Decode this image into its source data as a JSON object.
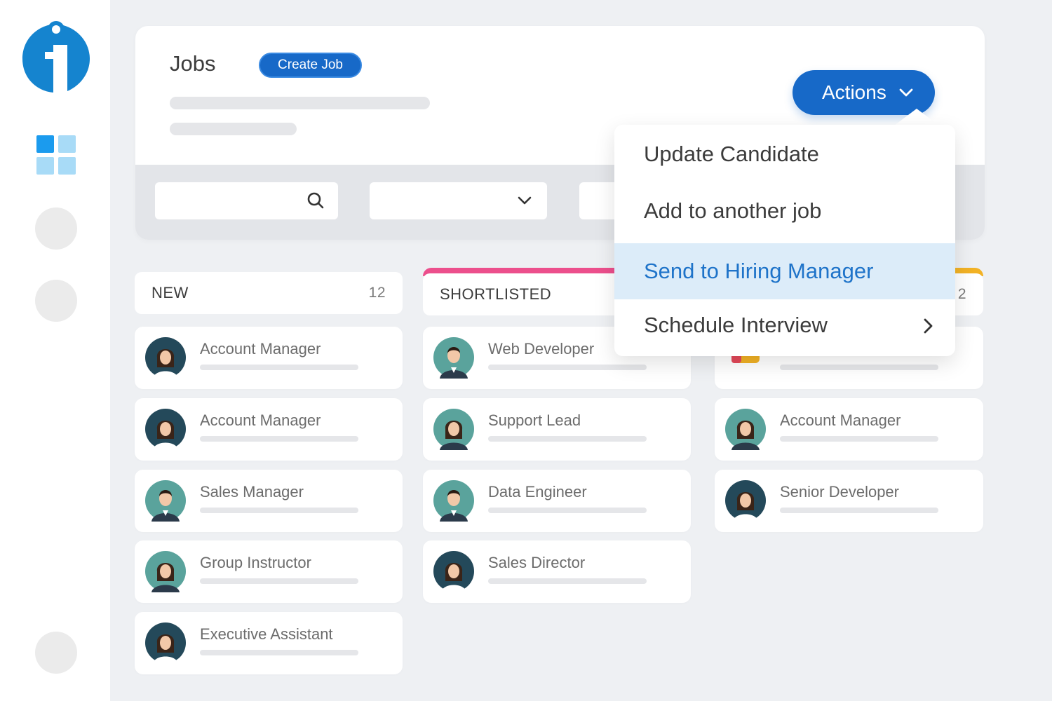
{
  "page": {
    "title": "Jobs",
    "create_button": "Create Job",
    "actions_button": "Actions"
  },
  "colors": {
    "primary": "#1769c8",
    "shortlisted_accent": "#ec4f8c",
    "third_accent": "#f2b225",
    "menu_highlight": "#dcecf9"
  },
  "actions_menu": {
    "items": [
      {
        "label": "Update Candidate"
      },
      {
        "label": "Add to another job"
      },
      {
        "label": "Send to Hiring Manager",
        "highlighted": true
      },
      {
        "label": "Schedule Interview",
        "has_submenu": true
      }
    ]
  },
  "columns": [
    {
      "name": "NEW",
      "count": "12",
      "cards": [
        {
          "title": "Account Manager",
          "avatar": "female-avatar-icon"
        },
        {
          "title": "Account Manager",
          "avatar": "female-avatar-icon"
        },
        {
          "title": "Sales Manager",
          "avatar": "male-avatar-icon"
        },
        {
          "title": "Group Instructor",
          "avatar": "female-avatar-icon"
        },
        {
          "title": "Executive Assistant",
          "avatar": "female-avatar-icon"
        }
      ]
    },
    {
      "name": "SHORTLISTED",
      "cards": [
        {
          "title": "Web Developer",
          "avatar": "male-avatar-icon"
        },
        {
          "title": "Support Lead",
          "avatar": "female-avatar-icon"
        },
        {
          "title": "Data Engineer",
          "avatar": "male-avatar-icon"
        },
        {
          "title": "Sales Director",
          "avatar": "female-avatar-icon"
        }
      ]
    },
    {
      "count": "2",
      "cards": [
        {
          "title": "",
          "avatar": "chat-icon"
        },
        {
          "title": "Account Manager",
          "avatar": "female-avatar-icon"
        },
        {
          "title": "Senior Developer",
          "avatar": "female-avatar-icon"
        }
      ]
    }
  ]
}
